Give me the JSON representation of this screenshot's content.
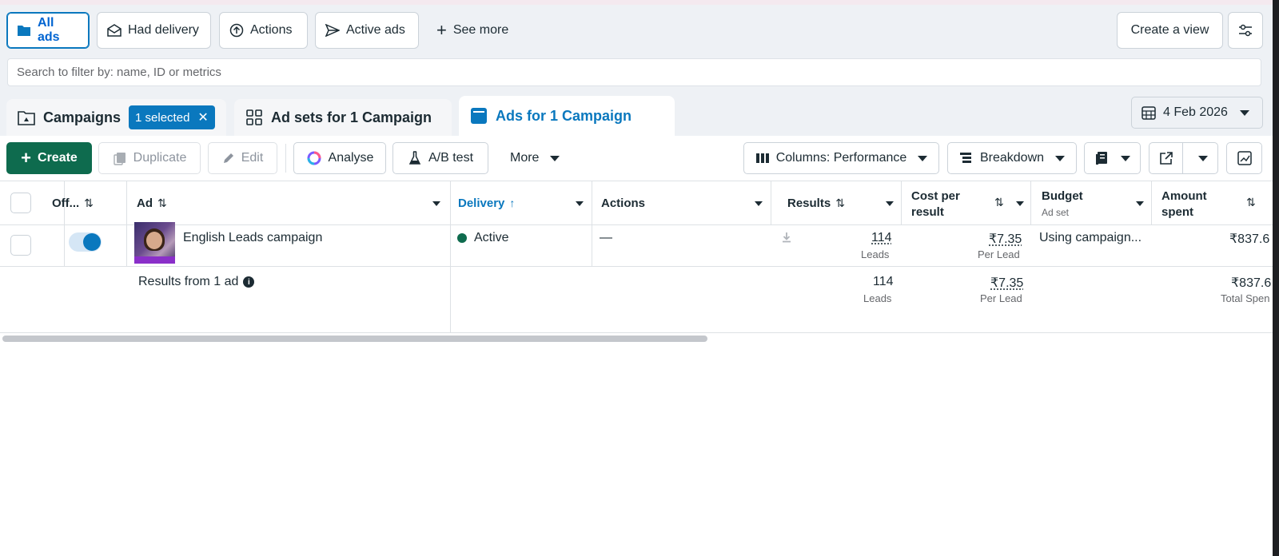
{
  "filters": {
    "all_ads": "All ads",
    "had_delivery": "Had delivery",
    "actions": "Actions",
    "active_ads": "Active ads",
    "see_more": "See more",
    "create_view": "Create a view"
  },
  "search": {
    "placeholder": "Search to filter by: name, ID or metrics"
  },
  "tabs": {
    "campaigns": "Campaigns",
    "selected_badge": "1 selected",
    "adsets": "Ad sets for 1 Campaign",
    "ads": "Ads for 1 Campaign"
  },
  "date": "4 Feb 2026",
  "toolbar": {
    "create": "Create",
    "duplicate": "Duplicate",
    "edit": "Edit",
    "analyse": "Analyse",
    "ab_test": "A/B test",
    "more": "More",
    "columns": "Columns: Performance",
    "breakdown": "Breakdown"
  },
  "table": {
    "headers": {
      "off": "Off...",
      "ad": "Ad",
      "delivery": "Delivery",
      "actions": "Actions",
      "results": "Results",
      "cost_l1": "Cost per",
      "cost_l2": "result",
      "budget": "Budget",
      "budget_sub": "Ad set",
      "spent_l1": "Amount",
      "spent_l2": "spent"
    },
    "row": {
      "ad_name": "English Leads campaign",
      "delivery": "Active",
      "actions": "—",
      "results": "114",
      "results_sub": "Leads",
      "cost": "₹7.35",
      "cost_sub": "Per Lead",
      "budget": "Using campaign...",
      "spent": "₹837.6"
    },
    "summary": {
      "label": "Results from 1 ad",
      "results": "114",
      "results_sub": "Leads",
      "cost": "₹7.35",
      "cost_sub": "Per Lead",
      "spent": "₹837.6",
      "spent_sub": "Total Spen"
    }
  },
  "colors": {
    "accent": "#0a78be",
    "create": "#0e6b4e",
    "active_dot": "#0e6b4e"
  }
}
